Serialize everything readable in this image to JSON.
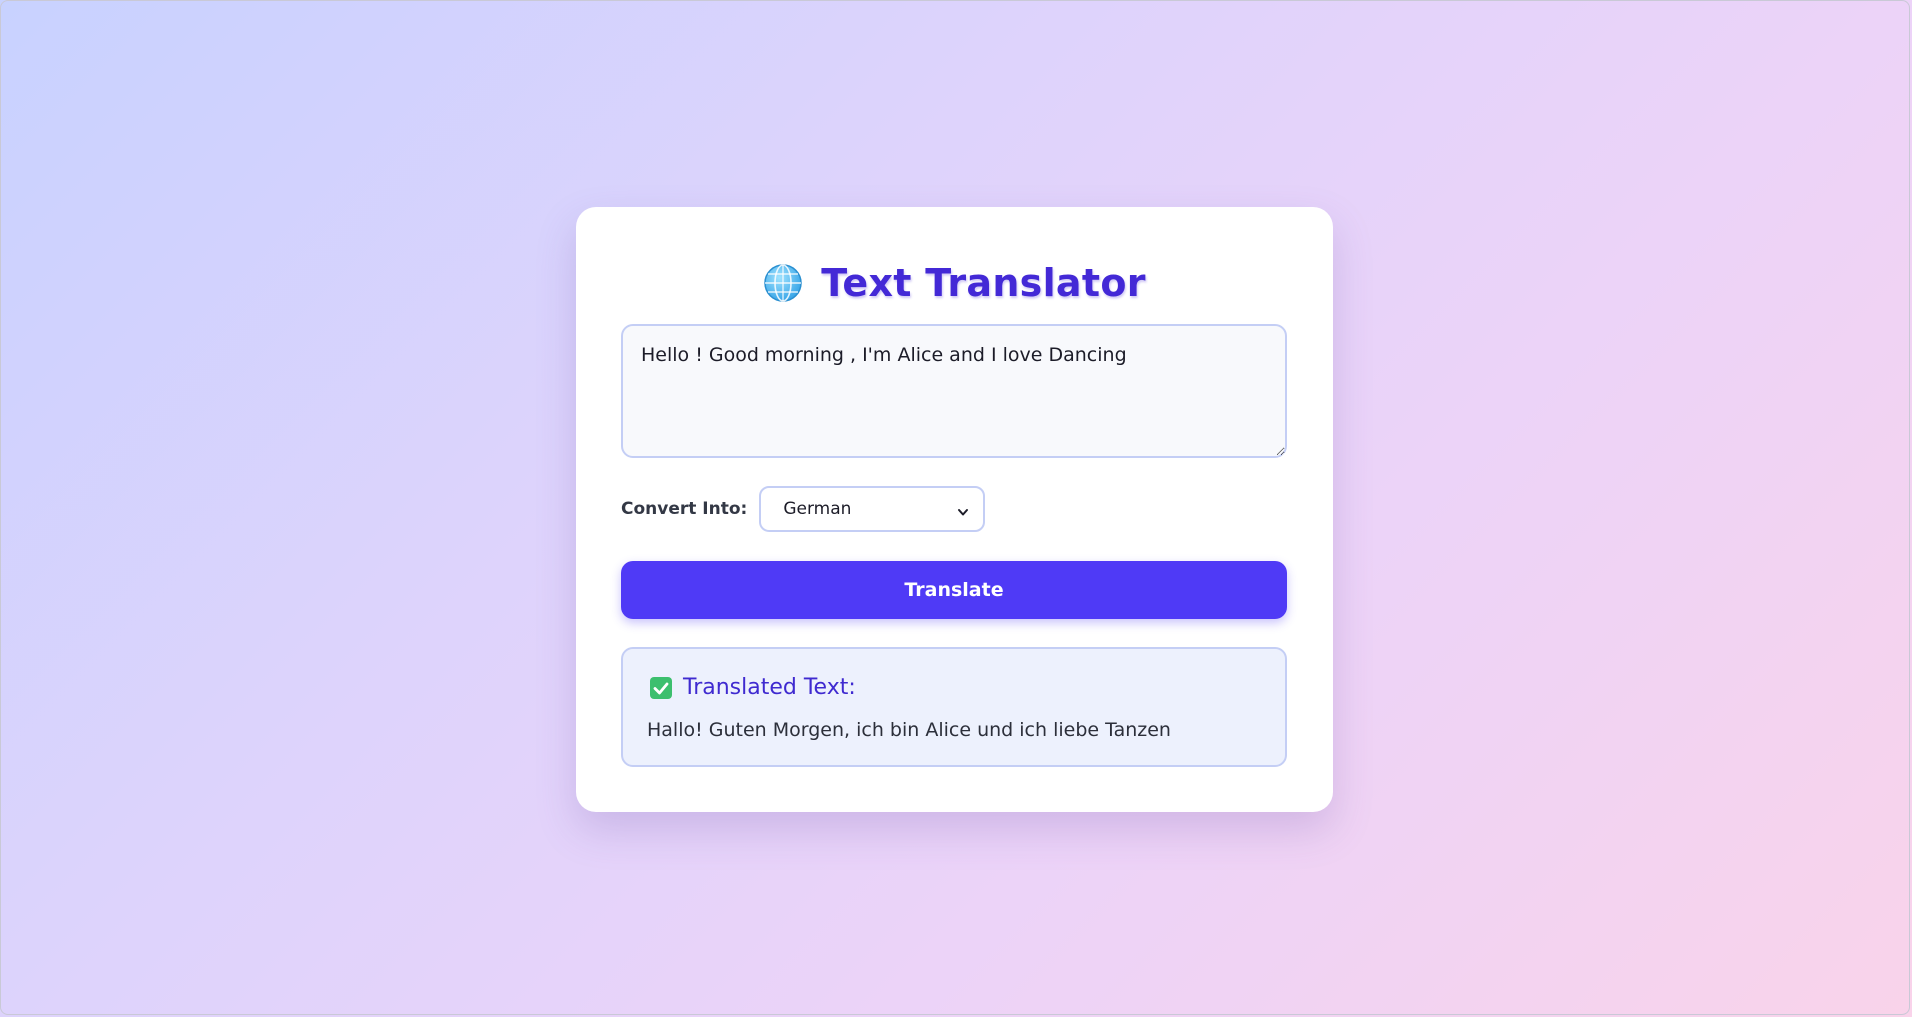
{
  "app": {
    "title": "Text Translator",
    "title_icon": "globe-icon"
  },
  "input": {
    "value": "Hello ! Good morning , I'm Alice and I love Dancing"
  },
  "convert": {
    "label": "Convert Into:",
    "selected": "German"
  },
  "translate_button": {
    "label": "Translate"
  },
  "result": {
    "icon": "check-mark-icon",
    "heading": "Translated Text:",
    "text": "Hallo! Guten Morgen, ich bin Alice und ich liebe Tanzen"
  },
  "colors": {
    "accent": "#4f3af6",
    "title": "#4329d6",
    "check": "#3cbf6e"
  }
}
